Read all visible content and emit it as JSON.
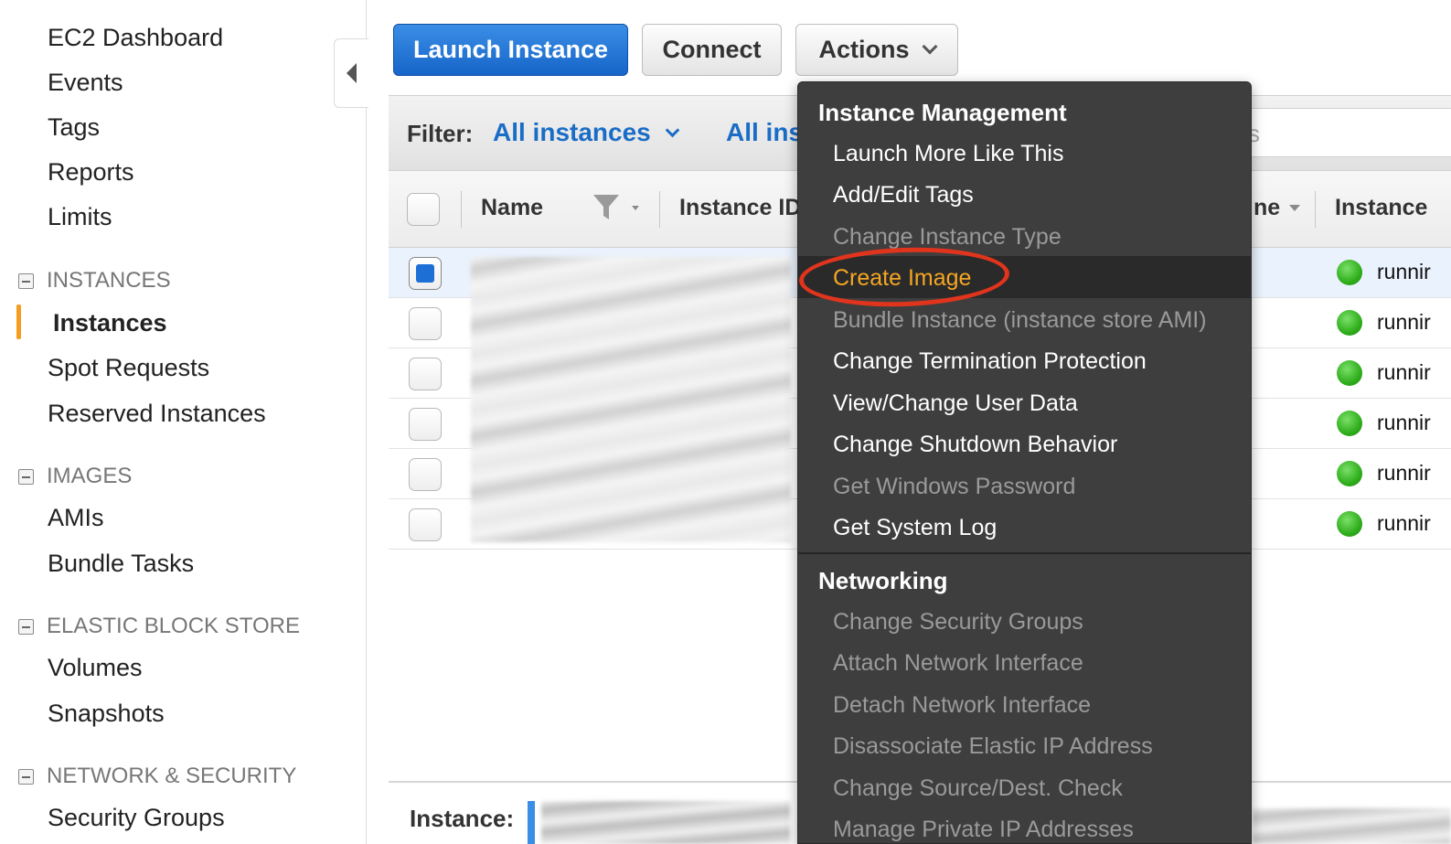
{
  "sidebar": {
    "top_items": [
      "EC2 Dashboard",
      "Events",
      "Tags",
      "Reports",
      "Limits"
    ],
    "sections": [
      {
        "title": "INSTANCES",
        "items": [
          "Instances",
          "Spot Requests",
          "Reserved Instances"
        ]
      },
      {
        "title": "IMAGES",
        "items": [
          "AMIs",
          "Bundle Tasks"
        ]
      },
      {
        "title": "ELASTIC BLOCK STORE",
        "items": [
          "Volumes",
          "Snapshots"
        ]
      },
      {
        "title": "NETWORK & SECURITY",
        "items": [
          "Security Groups"
        ]
      }
    ],
    "active_item": "Instances"
  },
  "toolbar": {
    "launch_label": "Launch Instance",
    "connect_label": "Connect",
    "actions_label": "Actions"
  },
  "filter": {
    "label": "Filter:",
    "primary_value": "All instances",
    "secondary_value": "All ins",
    "search_fragment": "s"
  },
  "table": {
    "headers": [
      "Name",
      "Instance ID",
      "ne",
      "Instance"
    ],
    "rows": [
      {
        "status": "runnir",
        "selected": true
      },
      {
        "status": "runnir",
        "selected": false
      },
      {
        "status": "runnir",
        "selected": false
      },
      {
        "status": "runnir",
        "selected": false
      },
      {
        "status": "runnir",
        "selected": false
      },
      {
        "status": "runnir",
        "selected": false
      }
    ]
  },
  "details": {
    "label": "Instance:"
  },
  "actions_menu": {
    "groups": [
      {
        "title": "Instance Management",
        "items": [
          {
            "label": "Launch More Like This",
            "state": "enabled"
          },
          {
            "label": "Add/Edit Tags",
            "state": "enabled"
          },
          {
            "label": "Change Instance Type",
            "state": "disabled"
          },
          {
            "label": "Create Image",
            "state": "highlight"
          },
          {
            "label": "Bundle Instance (instance store AMI)",
            "state": "disabled"
          },
          {
            "label": "Change Termination Protection",
            "state": "enabled"
          },
          {
            "label": "View/Change User Data",
            "state": "enabled"
          },
          {
            "label": "Change Shutdown Behavior",
            "state": "enabled"
          },
          {
            "label": "Get Windows Password",
            "state": "disabled"
          },
          {
            "label": "Get System Log",
            "state": "enabled"
          }
        ]
      },
      {
        "title": "Networking",
        "items": [
          {
            "label": "Change Security Groups",
            "state": "disabled"
          },
          {
            "label": "Attach Network Interface",
            "state": "disabled"
          },
          {
            "label": "Detach Network Interface",
            "state": "disabled"
          },
          {
            "label": "Disassociate Elastic IP Address",
            "state": "disabled"
          },
          {
            "label": "Change Source/Dest. Check",
            "state": "disabled"
          },
          {
            "label": "Manage Private IP Addresses",
            "state": "disabled"
          }
        ]
      }
    ]
  },
  "colors": {
    "accent_orange": "#f59d20",
    "primary_blue": "#1a6dc6",
    "menu_bg": "#3e3e3e",
    "highlight_text": "#f5a623",
    "annotation_red": "#e0341d",
    "status_green": "#2fae1c"
  }
}
